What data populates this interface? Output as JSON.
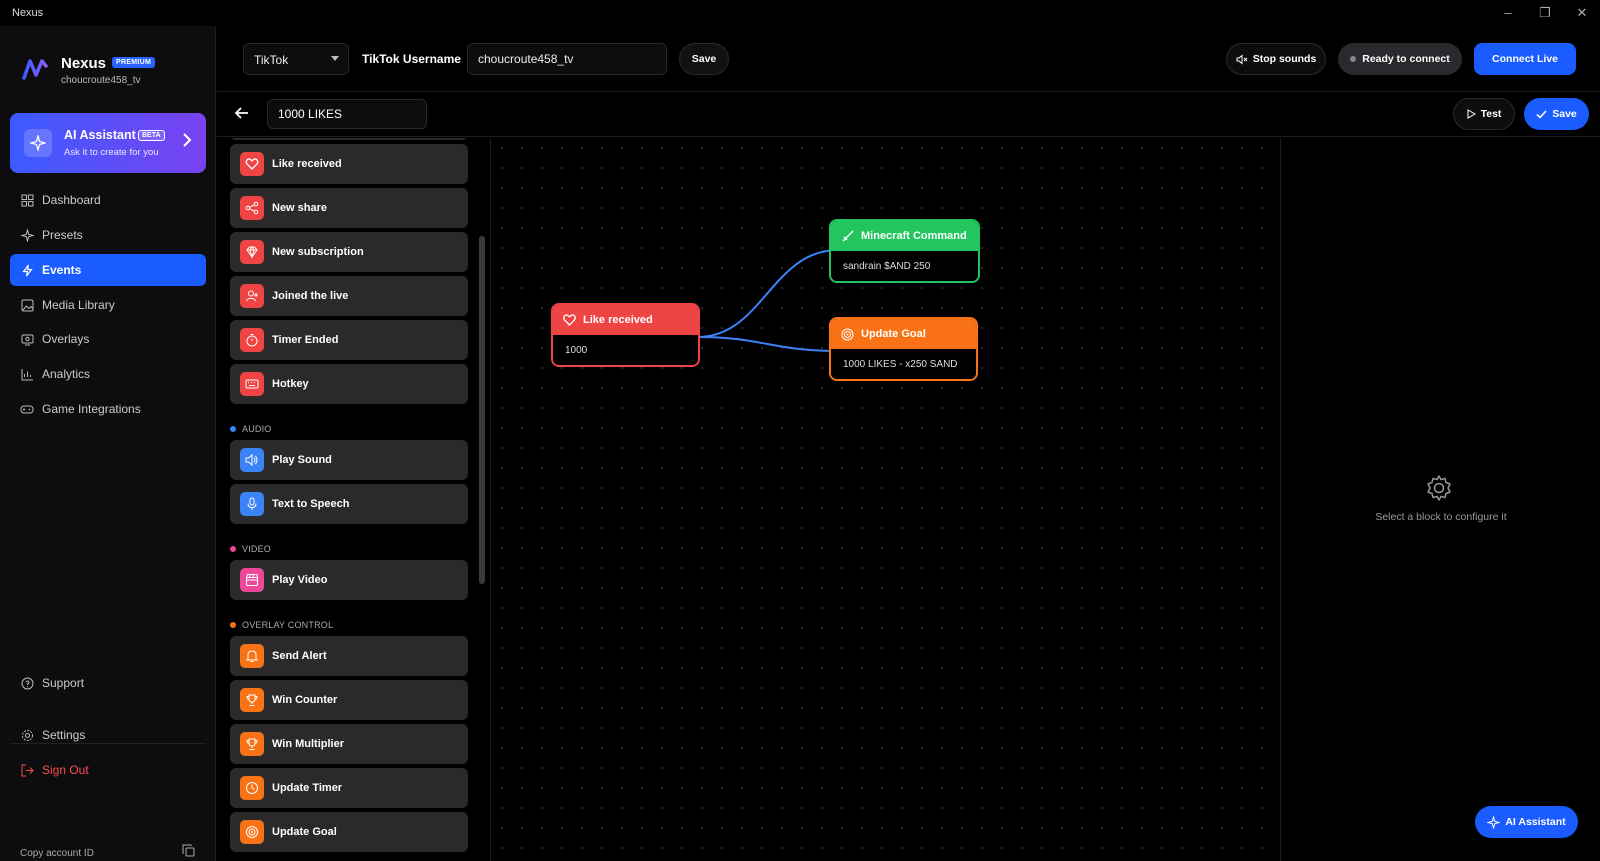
{
  "window": {
    "title": "Nexus"
  },
  "brand": {
    "name": "Nexus",
    "badge": "PREMIUM",
    "username": "choucroute458_tv"
  },
  "ai_card": {
    "title": "AI Assistant",
    "badge": "BETA",
    "subtitle": "Ask it to create for you"
  },
  "nav": {
    "dashboard": "Dashboard",
    "presets": "Presets",
    "events": "Events",
    "media": "Media Library",
    "overlays": "Overlays",
    "analytics": "Analytics",
    "games": "Game Integrations",
    "support": "Support",
    "settings": "Settings",
    "signout": "Sign Out",
    "copy_id": "Copy account ID"
  },
  "topbar": {
    "platform": "TikTok",
    "username_label": "TikTok Username",
    "username_value": "choucroute458_tv",
    "save": "Save",
    "stop_sounds": "Stop sounds",
    "ready": "Ready to connect",
    "connect": "Connect Live"
  },
  "subbar": {
    "event_name": "1000 LIKES",
    "test": "Test",
    "save": "Save"
  },
  "palette": {
    "triggers": [
      {
        "label": "Like received",
        "color": "#ef4444",
        "icon": "heart-icon"
      },
      {
        "label": "New share",
        "color": "#ef4444",
        "icon": "share-icon"
      },
      {
        "label": "New subscription",
        "color": "#ef4444",
        "icon": "gem-icon"
      },
      {
        "label": "Joined the live",
        "color": "#ef4444",
        "icon": "user-icon"
      },
      {
        "label": "Timer Ended",
        "color": "#ef4444",
        "icon": "timer-icon"
      },
      {
        "label": "Hotkey",
        "color": "#ef4444",
        "icon": "keyboard-icon"
      }
    ],
    "audio_title": "AUDIO",
    "audio": [
      {
        "label": "Play Sound",
        "color": "#3b82f6",
        "icon": "speaker-icon"
      },
      {
        "label": "Text to Speech",
        "color": "#3b82f6",
        "icon": "mic-icon"
      }
    ],
    "video_title": "VIDEO",
    "video": [
      {
        "label": "Play Video",
        "color": "#ec4899",
        "icon": "clapper-icon"
      }
    ],
    "overlay_title": "OVERLAY CONTROL",
    "overlay": [
      {
        "label": "Send Alert",
        "color": "#f97316",
        "icon": "bell-icon"
      },
      {
        "label": "Win Counter",
        "color": "#f97316",
        "icon": "trophy-icon"
      },
      {
        "label": "Win Multiplier",
        "color": "#f97316",
        "icon": "trophy-icon"
      },
      {
        "label": "Update Timer",
        "color": "#f97316",
        "icon": "clock-icon"
      },
      {
        "label": "Update Goal",
        "color": "#f97316",
        "icon": "target-icon"
      }
    ]
  },
  "nodes": {
    "trigger": {
      "title": "Like received",
      "value": "1000",
      "color": "#ef4444"
    },
    "minecraft": {
      "title": "Minecraft Command",
      "value": "sandrain $AND 250",
      "color": "#22c55e"
    },
    "goal": {
      "title": "Update Goal",
      "value": "1000 LIKES - x250 SAND",
      "color": "#f97316"
    }
  },
  "config": {
    "empty": "Select a block to configure it"
  },
  "fab": {
    "label": "AI Assistant"
  }
}
